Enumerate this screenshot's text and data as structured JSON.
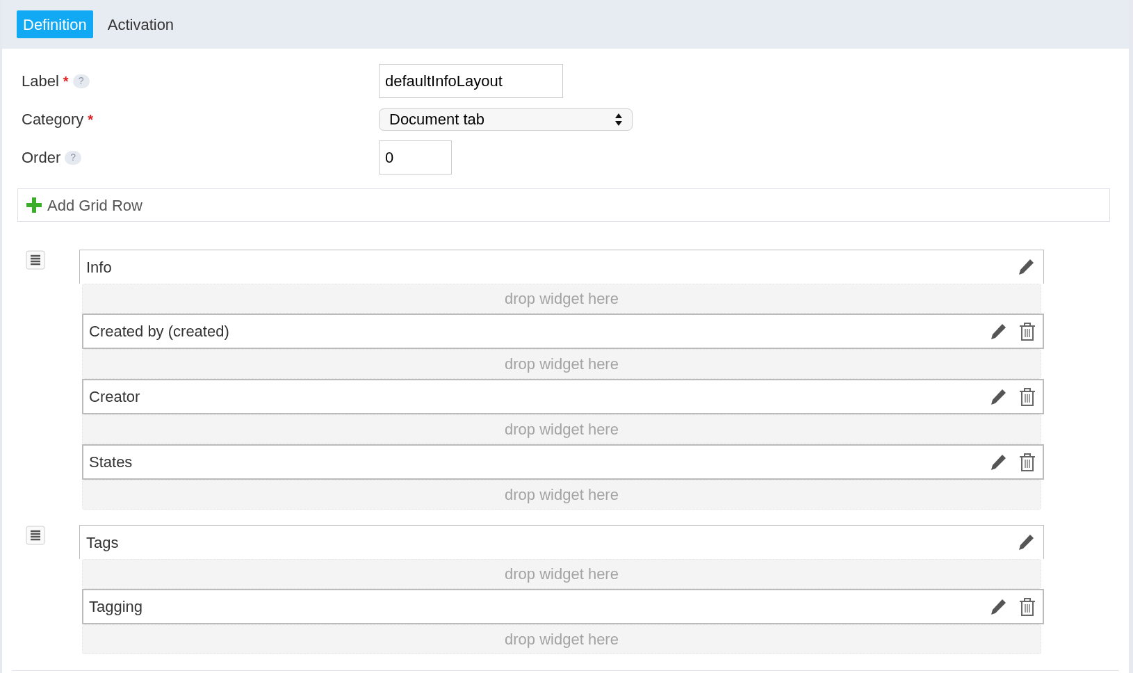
{
  "tabs": [
    {
      "label": "Definition",
      "selected": true
    },
    {
      "label": "Activation",
      "selected": false
    }
  ],
  "form": [
    {
      "label": "Label",
      "required_mark": "*",
      "help": "?",
      "kind": "text",
      "value": "defaultInfoLayout"
    },
    {
      "label": "Category",
      "required_mark": "*",
      "kind": "select",
      "value": "Document tab"
    },
    {
      "label": "Order",
      "help": "?",
      "kind": "number",
      "value": "0"
    }
  ],
  "add_button": "Add Grid Row",
  "grid_rows": [
    {
      "title": "Info",
      "drop_zone": "drop widget here",
      "widgets": [
        {
          "label": "Created by (created)",
          "drop_zone": "drop widget here"
        },
        {
          "label": "Creator",
          "drop_zone": "drop widget here"
        },
        {
          "label": "States",
          "drop_zone": "drop widget here"
        }
      ]
    },
    {
      "title": "Tags",
      "drop_zone": "drop widget here",
      "widgets": [
        {
          "label": "Tagging",
          "drop_zone": "drop widget here"
        }
      ]
    }
  ]
}
